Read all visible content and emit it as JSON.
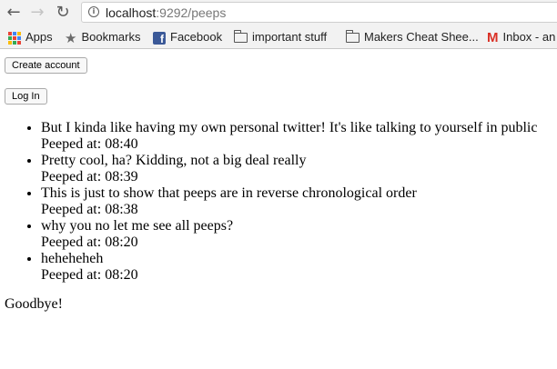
{
  "browser": {
    "url_host": "localhost",
    "url_path": ":9292/peeps",
    "back_icon": "arrow-left-icon",
    "forward_icon": "arrow-right-icon",
    "reload_icon": "reload-icon",
    "info_icon": "info-icon"
  },
  "bookmarks": [
    {
      "label": "Apps",
      "icon": "apps-grid-icon"
    },
    {
      "label": "Bookmarks",
      "icon": "star-icon"
    },
    {
      "label": "Facebook",
      "icon": "facebook-icon"
    },
    {
      "label": "important stuff",
      "icon": "folder-icon"
    },
    {
      "label": "Makers Cheat Shee...",
      "icon": "folder-icon"
    },
    {
      "label": "Inbox - an",
      "icon": "gmail-icon"
    }
  ],
  "page": {
    "create_account_label": "Create account",
    "log_in_label": "Log In",
    "peeps": [
      {
        "text": "But I kinda like having my own personal twitter! It's like talking to yourself in public",
        "time": "Peeped at: 08:40"
      },
      {
        "text": "Pretty cool, ha? Kidding, not a big deal really",
        "time": "Peeped at: 08:39"
      },
      {
        "text": "This is just to show that peeps are in reverse chronological order",
        "time": "Peeped at: 08:38"
      },
      {
        "text": "why you no let me see all peeps?",
        "time": "Peeped at: 08:20"
      },
      {
        "text": "heheheheh",
        "time": "Peeped at: 08:20"
      }
    ],
    "goodbye": "Goodbye!"
  }
}
